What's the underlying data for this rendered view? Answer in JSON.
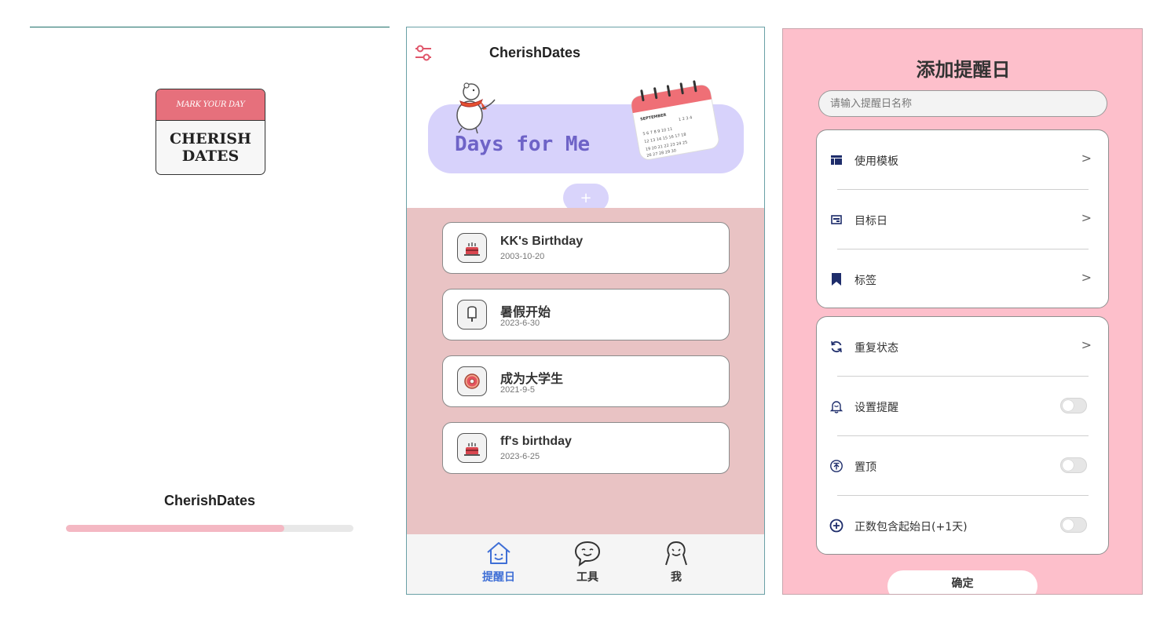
{
  "splash": {
    "logo_tagline": "MARK YOUR DAY",
    "logo_line1": "CHERISH",
    "logo_line2": "DATES",
    "app_name": "CherishDates",
    "progress": 0.76,
    "progress_color": "#f4b8c3"
  },
  "home": {
    "title": "CherishDates",
    "banner_text": "Days for Me",
    "calendar_month": "SEPTEMBER",
    "add_label": "+",
    "items": [
      {
        "title": "KK's Birthday",
        "date": "2003-10-20",
        "icon": "cake-icon"
      },
      {
        "title": "暑假开始",
        "date": "2023-6-30",
        "icon": "popsicle-icon"
      },
      {
        "title": "成为大学生",
        "date": "2021-9-5",
        "icon": "donut-icon"
      },
      {
        "title": "ff's birthday",
        "date": "2023-6-25",
        "icon": "cake-icon"
      }
    ],
    "tabs": [
      {
        "label": "提醒日",
        "icon": "house-icon",
        "active": true
      },
      {
        "label": "工具",
        "icon": "chat-bubble-icon",
        "active": false
      },
      {
        "label": "我",
        "icon": "person-icon",
        "active": false
      }
    ],
    "colors": {
      "banner": "#d7d2fb",
      "banner_text": "#6e63c7",
      "list_bg": "#e9c3c4",
      "active_tab": "#3f6fd6"
    }
  },
  "add": {
    "title": "添加提醒日",
    "name_placeholder": "请输入提醒日名称",
    "group1": [
      {
        "label": "使用模板",
        "icon": "template-icon"
      },
      {
        "label": "目标日",
        "icon": "calendar-card-icon"
      },
      {
        "label": "标签",
        "icon": "bookmark-icon"
      }
    ],
    "group2": [
      {
        "label": "重复状态",
        "icon": "repeat-icon",
        "control": "chevron"
      },
      {
        "label": "设置提醒",
        "icon": "bell-icon",
        "control": "toggle",
        "on": false
      },
      {
        "label": "置顶",
        "icon": "pin-top-icon",
        "control": "toggle",
        "on": false
      },
      {
        "label": "正数包含起始日(+1天)",
        "icon": "plus-circle-icon",
        "control": "toggle",
        "on": false
      }
    ],
    "chevron": ">",
    "confirm_label": "确定",
    "colors": {
      "background": "#fdbfcb",
      "icon": "#1e2d6b"
    }
  }
}
